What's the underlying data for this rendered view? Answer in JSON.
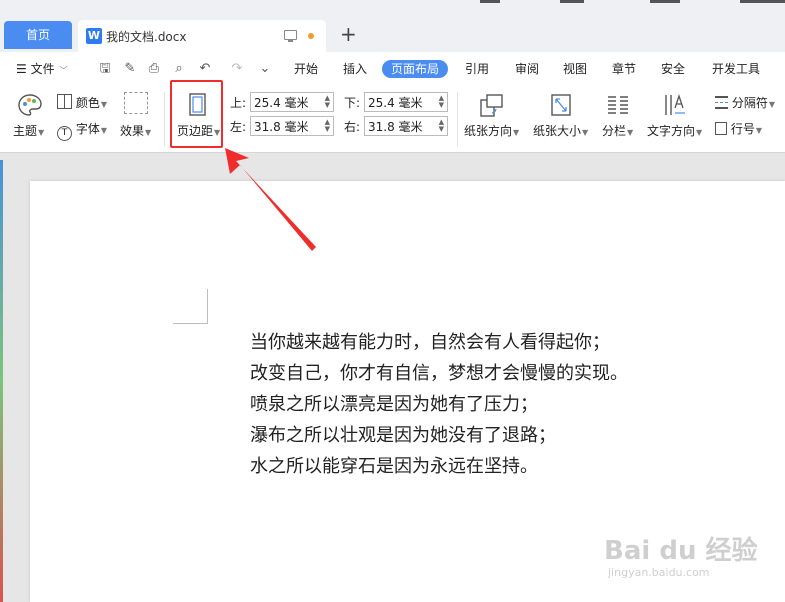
{
  "titlebar": {
    "home_tab": "首页",
    "doc_tab": "我的文档.docx",
    "doc_icon": "W",
    "new_tab": "+"
  },
  "menu": {
    "file_label": "文件",
    "ribbon_tabs": [
      "开始",
      "插入",
      "页面布局",
      "引用",
      "审阅",
      "视图",
      "章节",
      "安全",
      "开发工具"
    ],
    "active_tab": "页面布局"
  },
  "ribbon": {
    "theme": "主题",
    "color": "颜色",
    "font": "字体",
    "effect": "效果",
    "margins": "页边距",
    "top_label": "上:",
    "top_value": "25.4 毫米",
    "bottom_label": "下:",
    "bottom_value": "25.4 毫米",
    "left_label": "左:",
    "left_value": "31.8 毫米",
    "right_label": "右:",
    "right_value": "31.8 毫米",
    "orientation": "纸张方向",
    "paper_size": "纸张大小",
    "columns": "分栏",
    "text_direction": "文字方向",
    "separator": "分隔符",
    "line_number": "行号"
  },
  "document": {
    "lines": [
      "当你越来越有能力时，自然会有人看得起你；",
      "改变自己，你才有自信，梦想才会慢慢的实现。",
      "喷泉之所以漂亮是因为她有了压力；",
      "瀑布之所以壮观是因为她没有了退路；",
      "水之所以能穿石是因为永远在坚持。"
    ]
  },
  "watermark": {
    "brand": "Bai du 经验",
    "url": "jingyan.baidu.com"
  },
  "colors": {
    "accent": "#4a8cf0",
    "highlight_red": "#f02d2d"
  }
}
